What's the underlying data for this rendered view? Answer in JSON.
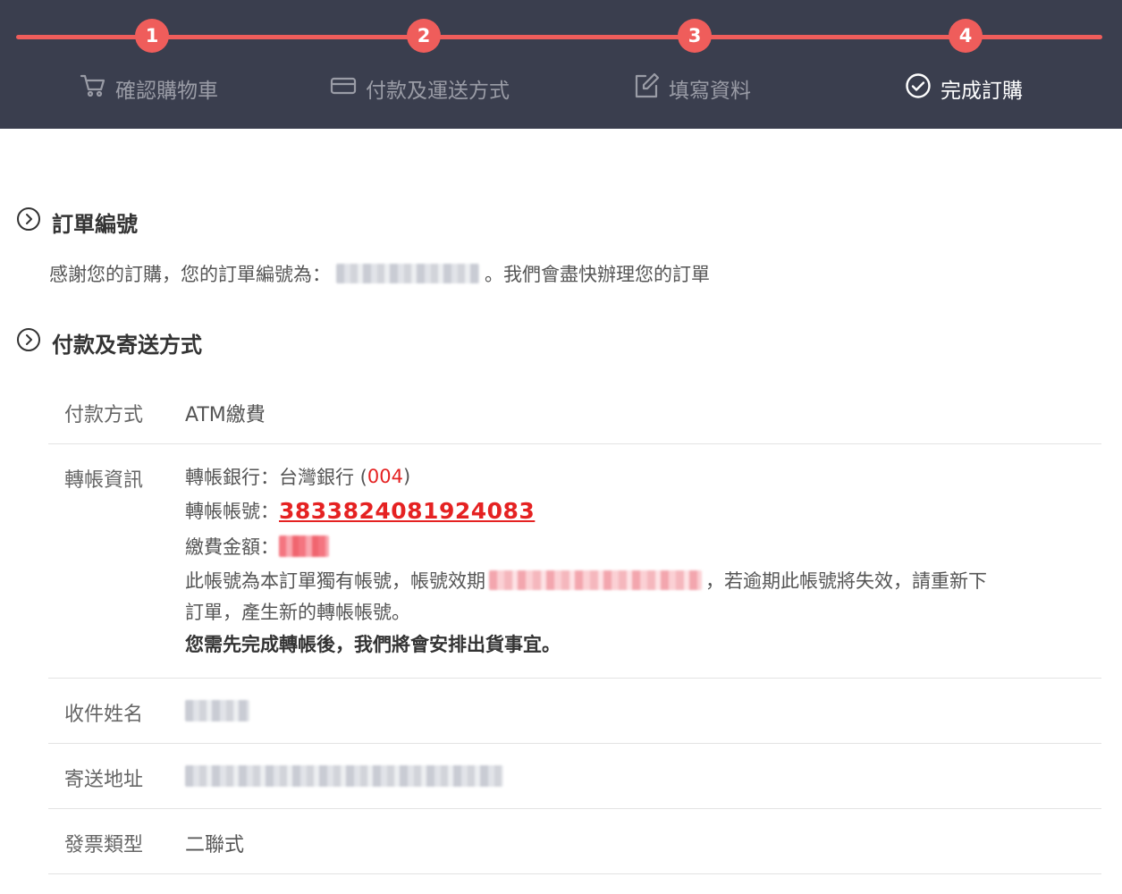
{
  "steps": [
    {
      "num": "1",
      "label": "確認購物車",
      "icon": "cart-icon"
    },
    {
      "num": "2",
      "label": "付款及運送方式",
      "icon": "card-icon"
    },
    {
      "num": "3",
      "label": "填寫資料",
      "icon": "edit-icon"
    },
    {
      "num": "4",
      "label": "完成訂購",
      "icon": "check-circle-icon"
    }
  ],
  "colors": {
    "header_bg": "#3a3e4e",
    "accent": "#ef5d5b",
    "account_red": "#e52222"
  },
  "order": {
    "title": "訂單編號",
    "thanks_prefix": "感謝您的訂購，您的訂單編號為：",
    "thanks_suffix": "。我們會盡快辦理您的訂單"
  },
  "shipping": {
    "title": "付款及寄送方式",
    "payment_label": "付款方式",
    "payment_value": "ATM繳費",
    "transfer_label": "轉帳資訊",
    "bank_prefix": "轉帳銀行：台灣銀行 (",
    "bank_code": "004",
    "bank_suffix": ")",
    "account_label": "轉帳帳號：",
    "account_number": "3833824081924083",
    "amount_label": "繳費金額：",
    "note_line1_prefix": "此帳號為本訂單獨有帳號，帳號效期",
    "note_line1_suffix": "，若逾期此帳號將失效，請重新下",
    "note_line2": "訂單，產生新的轉帳帳號。",
    "note_bold": "您需先完成轉帳後，我們將會安排出貨事宜。",
    "recipient_label": "收件姓名",
    "address_label": "寄送地址",
    "invoice_label": "發票類型",
    "invoice_value": "二聯式"
  }
}
